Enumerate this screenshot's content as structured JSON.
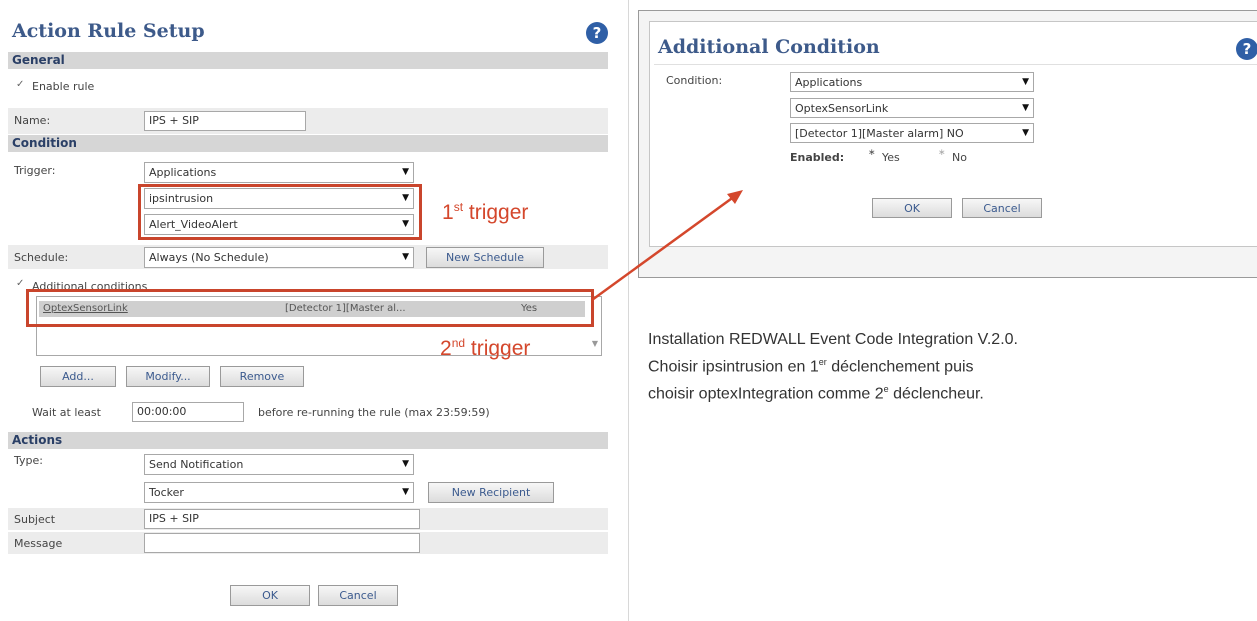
{
  "left": {
    "title": "Action Rule Setup",
    "general": {
      "section": "General",
      "enable_rule": "Enable rule",
      "name_label": "Name:",
      "name_value": "IPS + SIP"
    },
    "condition": {
      "section": "Condition",
      "trigger_label": "Trigger:",
      "trigger_selects": [
        "Applications",
        "ipsintrusion",
        "Alert_VideoAlert"
      ],
      "first_trigger": "1",
      "first_trigger_sup": "st",
      "first_trigger_word": " trigger",
      "schedule_label": "Schedule:",
      "schedule_value": "Always (No Schedule)",
      "new_schedule": "New Schedule",
      "additional_conditions": "Additional conditions",
      "list_row": {
        "col1": "OptexSensorLink",
        "col2": "[Detector 1][Master al...",
        "col3": "Yes"
      },
      "second_trigger": "2",
      "second_trigger_sup": "nd",
      "second_trigger_word": " trigger",
      "add": "Add...",
      "modify": "Modify...",
      "remove": "Remove",
      "wait_label": "Wait at least",
      "wait_value": "00:00:00",
      "wait_suffix": "before re-running the rule (max 23:59:59)"
    },
    "actions": {
      "section": "Actions",
      "type_label": "Type:",
      "type_value": "Send Notification",
      "recipient_value": "Tocker",
      "new_recipient": "New Recipient",
      "subject_label": "Subject",
      "subject_value": "IPS + SIP",
      "message_label": "Message",
      "message_value": ""
    },
    "ok": "OK",
    "cancel": "Cancel"
  },
  "dialog": {
    "title": "Additional Condition",
    "condition_label": "Condition:",
    "selects": [
      "Applications",
      "OptexSensorLink",
      "[Detector 1][Master alarm] NO"
    ],
    "enabled_label": "Enabled:",
    "yes": "Yes",
    "no": "No",
    "ok": "OK",
    "cancel": "Cancel"
  },
  "caption": {
    "line1": "Installation REDWALL Event Code Integration V.2.0.",
    "line2a": "Choisir ipsintrusion en 1",
    "line2sup": "er",
    "line2b": " déclenchement puis",
    "line3a": "choisir optexIntegration comme 2",
    "line3sup": "e",
    "line3b": " déclencheur."
  },
  "colors": {
    "annotation_red": "#c9452c",
    "title_blue": "#3d5a8a",
    "section_gray": "#d6d6d6"
  },
  "icons": [
    "help-icon",
    "dropdown-arrow-icon",
    "checkbox-icon",
    "radio-icon",
    "annotation-arrow-icon"
  ]
}
